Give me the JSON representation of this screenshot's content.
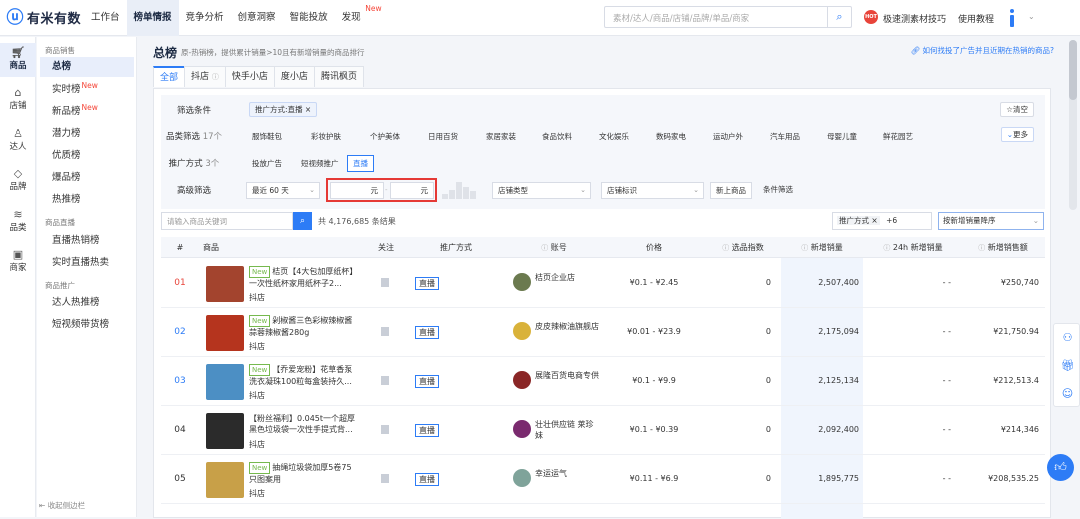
{
  "brand": {
    "logo_text": "有米有数"
  },
  "nav": [
    {
      "label": "工作台",
      "new": ""
    },
    {
      "label": "榜单情报",
      "new": ""
    },
    {
      "label": "竞争分析",
      "new": ""
    },
    {
      "label": "创意洞察",
      "new": ""
    },
    {
      "label": "智能投放",
      "new": ""
    },
    {
      "label": "发现",
      "new": "New"
    }
  ],
  "search": {
    "placeholder": "素材/达人/商品/店铺/品牌/单品/商家"
  },
  "header_right": {
    "hot_badge": "HOT",
    "hot_text": "极速测素材技巧",
    "tutorial": "使用教程"
  },
  "sidebar": [
    {
      "label": "商品",
      "icon": "cart-icon"
    },
    {
      "label": "店铺",
      "icon": "store-icon"
    },
    {
      "label": "达人",
      "icon": "person-icon"
    },
    {
      "label": "品牌",
      "icon": "brand-icon"
    },
    {
      "label": "品类",
      "icon": "layers-icon"
    },
    {
      "label": "商家",
      "icon": "merchant-icon"
    }
  ],
  "subnav": {
    "group1": "商品销售",
    "items1": [
      {
        "label": "总榜",
        "new": ""
      },
      {
        "label": "实时榜",
        "new": "New"
      },
      {
        "label": "新品榜",
        "new": "New"
      },
      {
        "label": "潜力榜",
        "new": ""
      },
      {
        "label": "优质榜",
        "new": ""
      },
      {
        "label": "爆品榜",
        "new": ""
      },
      {
        "label": "热推榜",
        "new": ""
      }
    ],
    "group2": "商品直播",
    "items2": [
      {
        "label": "直播热销榜"
      },
      {
        "label": "实时直播热卖"
      }
    ],
    "group3": "商品推广",
    "items3": [
      {
        "label": "达人热推榜"
      },
      {
        "label": "短视频带货榜"
      }
    ],
    "collapse": "收起侧边栏"
  },
  "page": {
    "title": "总榜",
    "desc": "原-热销榜，提供累计销量>10且有新增销量的商品排行",
    "help_link": "如何找投了广告并且近期在热销的商品?"
  },
  "tabs": [
    {
      "label": "全部"
    },
    {
      "label": "抖店"
    },
    {
      "label": "快手小店"
    },
    {
      "label": "度小店"
    },
    {
      "label": "腾讯枫页"
    }
  ],
  "filters": {
    "cond_label": "筛选条件",
    "cond_chip": "推广方式:直播 ×",
    "clear": "☆清空",
    "cat_label": "品类筛选",
    "cat_count": "17个",
    "categories": [
      "服饰鞋包",
      "彩妆护肤",
      "个护美体",
      "日用百货",
      "家居家装",
      "食品饮料",
      "文化娱乐",
      "数码家电",
      "运动户外",
      "汽车用品",
      "母婴儿童",
      "鲜花园艺"
    ],
    "more": "更多",
    "promo_label": "推广方式",
    "promo_count": "3个",
    "promo_methods": [
      "投放广告",
      "短视频推广",
      "直播"
    ],
    "adv_label": "高级筛选",
    "period": "最近 60 天",
    "price_unit": "元",
    "store_type": "店铺类型",
    "store_tag": "店铺标识",
    "new_store": "新上商品",
    "cond_filter": "条件筛选"
  },
  "toolbar": {
    "kw_placeholder": "请输入商品关键词",
    "total": "共 4,176,685 条结果",
    "promo_sel": "推广方式 ×",
    "promo_extra": "+6",
    "sort": "按新增销量降序"
  },
  "table": {
    "headers": [
      "#",
      "商品",
      "关注",
      "推广方式",
      "账号",
      "价格",
      "选品指数",
      "新增销量",
      "24h 新增销量",
      "新增销售额"
    ],
    "rows": [
      {
        "rank": "01",
        "new": "New",
        "name": "桔页【4大包加厚纸杯】一次性纸杯家用纸杯子2...",
        "platform": "抖店",
        "promo": "直播",
        "account": "桔页企业店",
        "price": "¥0.1 - ¥2.45",
        "index": "0",
        "sales": "2,507,400",
        "sales24": "- -",
        "amount": "¥250,740",
        "thumb": "#a3442e",
        "avatar": "#6b7a4f"
      },
      {
        "rank": "02",
        "new": "New",
        "name": "剁椒酱三色彩椒辣椒酱蒜蓉辣椒酱280g",
        "platform": "抖店",
        "promo": "直播",
        "account": "皮皮辣椒油旗舰店",
        "price": "¥0.01 - ¥23.9",
        "index": "0",
        "sales": "2,175,094",
        "sales24": "- -",
        "amount": "¥21,750.94",
        "thumb": "#b5341e",
        "avatar": "#d9b23a"
      },
      {
        "rank": "03",
        "new": "New",
        "name": "【乔爱宠粉】花草香泵洗衣凝珠100粒每盒装持久...",
        "platform": "抖店",
        "promo": "直播",
        "account": "展隆百货电商专供",
        "price": "¥0.1 - ¥9.9",
        "index": "0",
        "sales": "2,125,134",
        "sales24": "- -",
        "amount": "¥212,513.4",
        "thumb": "#4c8fc4",
        "avatar": "#8a2626"
      },
      {
        "rank": "04",
        "new": "",
        "name": "【粉丝福利】0.045t一个超厚黑色垃圾袋一次性手提式背...",
        "platform": "抖店",
        "promo": "直播",
        "account": "壮壮供应链 莱珍妹",
        "price": "¥0.1 - ¥0.39",
        "index": "0",
        "sales": "2,092,400",
        "sales24": "- -",
        "amount": "¥214,346",
        "thumb": "#2b2b2b",
        "avatar": "#7a2a6e"
      },
      {
        "rank": "05",
        "new": "New",
        "name": "抽绳垃圾袋加厚5卷75只图案用",
        "platform": "抖店",
        "promo": "直播",
        "account": "幸运运气",
        "price": "¥0.11 - ¥6.9",
        "index": "0",
        "sales": "1,895,775",
        "sales24": "- -",
        "amount": "¥208,535.25",
        "thumb": "#c8a048",
        "avatar": "#7fa39a"
      }
    ]
  }
}
